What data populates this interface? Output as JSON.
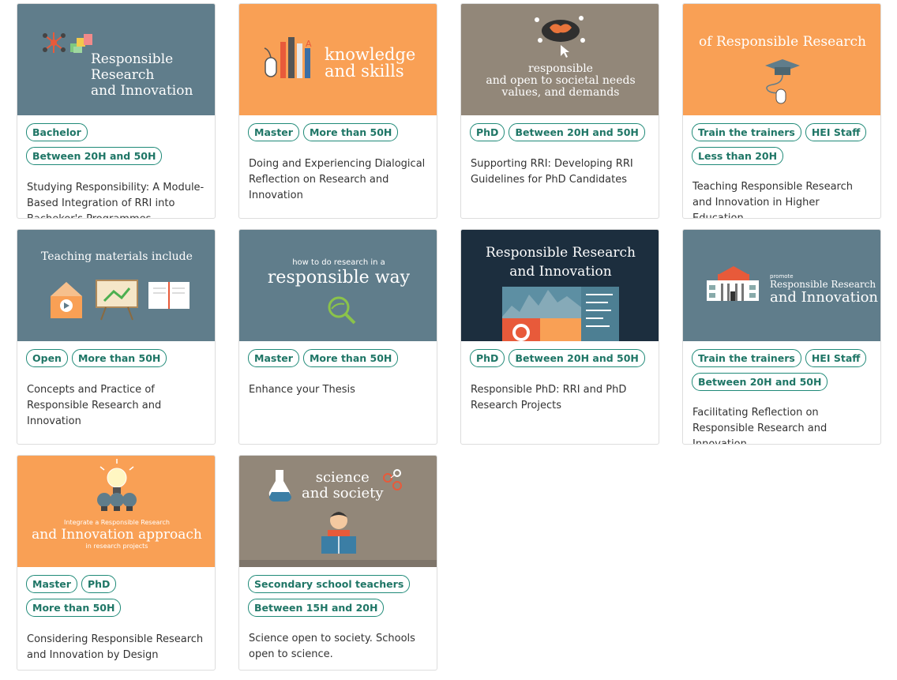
{
  "cards": [
    {
      "tags": [
        "Bachelor",
        "Between 20H and 50H"
      ],
      "title": "Studying Responsibility: A Module-Based Integration of RRI into Bachekor's Programmes",
      "thumb_text": [
        "Responsible",
        "Research",
        "and Innovation"
      ],
      "bg": "#607d8b"
    },
    {
      "tags": [
        "Master",
        "More than 50H"
      ],
      "title": "Doing and Experiencing Dialogical Reflection on Research and Innovation",
      "thumb_text": [
        "knowledge",
        "and skills"
      ],
      "bg": "#f9a055"
    },
    {
      "tags": [
        "PhD",
        "Between 20H and 50H"
      ],
      "title": "Supporting RRI: Developing RRI Guidelines for PhD Candidates",
      "thumb_text": [
        "responsible",
        "and open to societal needs",
        "values, and demands"
      ],
      "bg": "#928779"
    },
    {
      "tags": [
        "Train the trainers",
        "HEI Staff",
        "Less than 20H"
      ],
      "title": "Teaching Responsible Research and Innovation in Higher Education",
      "thumb_text": [
        "of Responsible Research"
      ],
      "bg": "#f9a055"
    },
    {
      "tags": [
        "Open",
        "More than 50H"
      ],
      "title": "Concepts and Practice of Responsible Research and Innovation",
      "thumb_text": [
        "Teaching materials include"
      ],
      "bg": "#607d8b"
    },
    {
      "tags": [
        "Master",
        "More than 50H"
      ],
      "title": "Enhance your Thesis",
      "thumb_text": [
        "how to do research in a",
        "responsible way"
      ],
      "bg": "#607d8b"
    },
    {
      "tags": [
        "PhD",
        "Between 20H and 50H"
      ],
      "title": "Responsible PhD: RRI and PhD Research Projects",
      "thumb_text": [
        "Responsible Research",
        "and Innovation"
      ],
      "bg": "#1c2e3e"
    },
    {
      "tags": [
        "Train the trainers",
        "HEI Staff",
        "Between 20H and 50H"
      ],
      "title": "Facilitating Reflection on Responsible Research and Innovation",
      "thumb_text": [
        "promote",
        "Responsible Research",
        "and Innovation"
      ],
      "bg": "#607d8b"
    },
    {
      "tags": [
        "Master",
        "PhD",
        "More than 50H"
      ],
      "title": "Considering Responsible Research and Innovation by Design",
      "thumb_text": [
        "Integrate a Responsible Research",
        "and Innovation approach",
        "in research projects"
      ],
      "bg": "#f9a055"
    },
    {
      "tags": [
        "Secondary school teachers",
        "Between 15H and 20H"
      ],
      "title": "Science open to society. Schools open to science.",
      "thumb_text": [
        "science",
        "and society"
      ],
      "bg": "#928779"
    }
  ]
}
